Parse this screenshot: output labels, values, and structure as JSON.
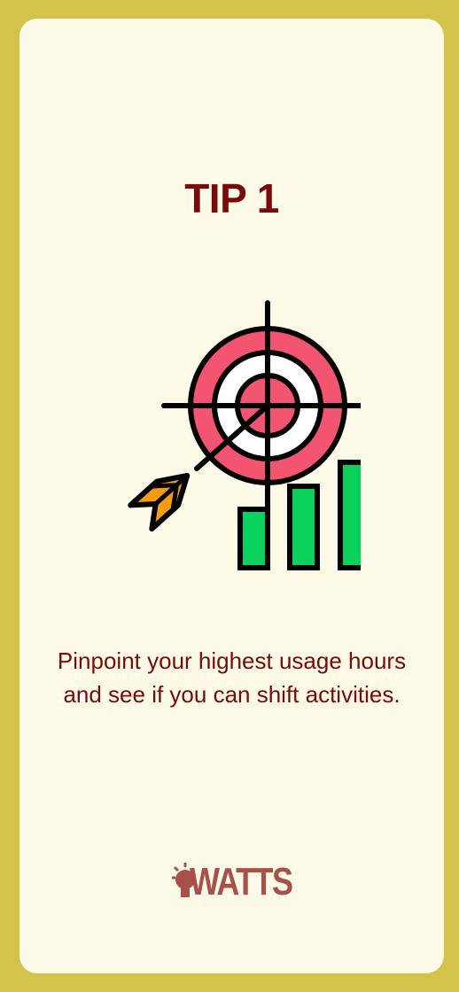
{
  "title": "TIP 1",
  "illustration": {
    "icon": "target-arrow-growth-icon",
    "colors": {
      "target_ring": "#f35470",
      "target_center": "#ffffff",
      "arrow_fletching": "#f39c12",
      "bars": "#0ad15c",
      "outline": "#000000"
    }
  },
  "body_text": "Pinpoint your highest usage hours and see if you can shift activities.",
  "brand": {
    "name": "WATTS",
    "icon": "lightbulb-icon",
    "color": "#a8514a"
  },
  "colors": {
    "frame": "#d3c34a",
    "card": "#fdfae8",
    "text": "#7a0a0a"
  }
}
